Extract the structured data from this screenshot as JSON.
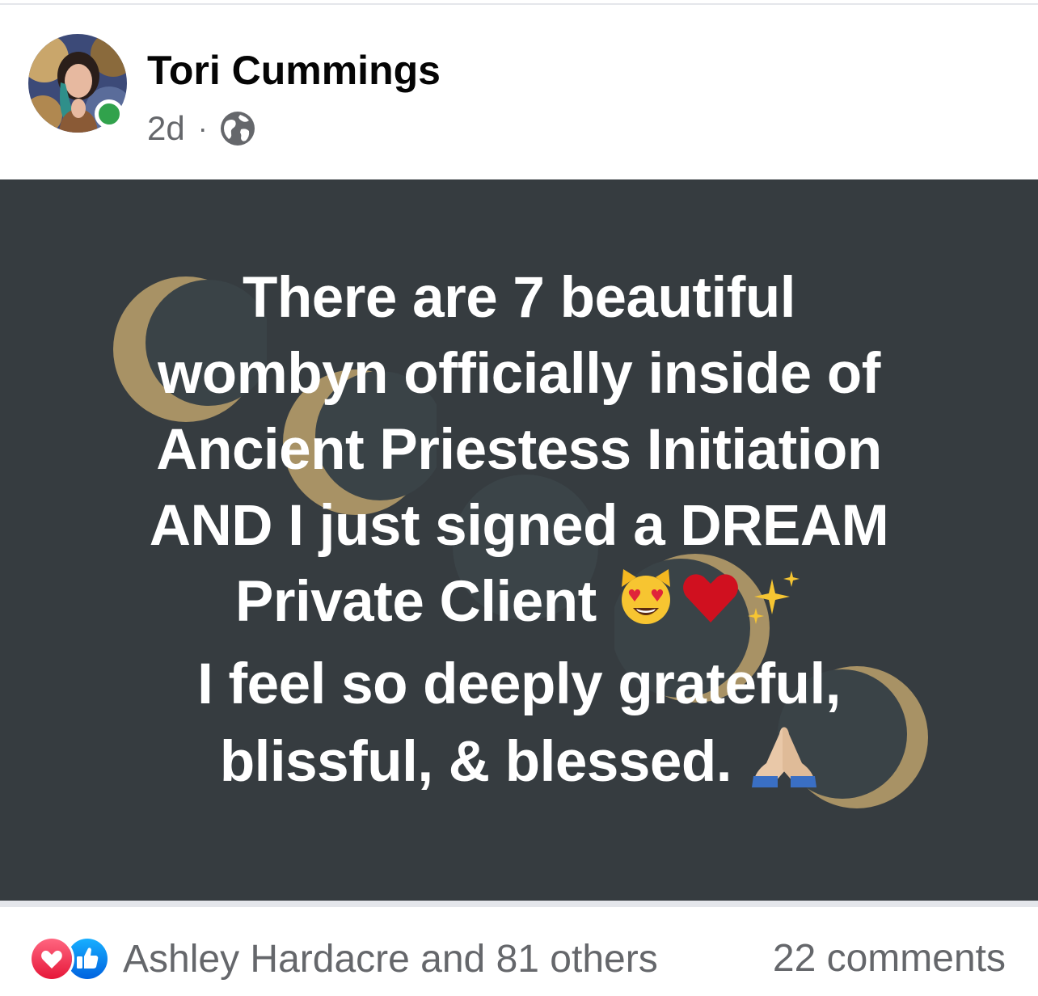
{
  "post": {
    "author": "Tori Cummings",
    "timestamp": "2d",
    "separator": "·",
    "privacy_icon": "globe-icon",
    "online_status_color": "#31a24c",
    "image": {
      "background_color": "#363c40",
      "moon_color": "#a89265",
      "text_lines": [
        "There are 7 beautiful",
        "wombyn officially inside of",
        "Ancient Priestess Initiation",
        "AND I just signed a DREAM",
        "Private Client",
        "I feel so deeply grateful,",
        "blissful, & blessed."
      ],
      "emojis": [
        "heart-eyes-cat",
        "red-heart",
        "sparkles",
        "folded-hands"
      ]
    },
    "reactions": {
      "icons": [
        "love-icon",
        "like-icon"
      ],
      "summary": "Ashley Hardacre and 81 others"
    },
    "comments": "22 comments"
  }
}
